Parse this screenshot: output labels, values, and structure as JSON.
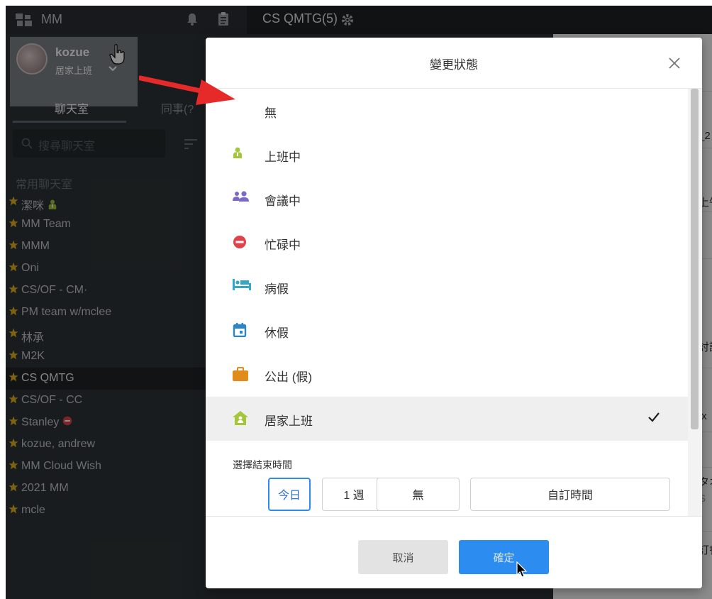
{
  "app": {
    "title": "MM",
    "room_title": "CS QMTG(5)"
  },
  "profile": {
    "name": "kozue",
    "status": "居家上班"
  },
  "tabs": {
    "chat": "聊天室",
    "colleague": "同事(?"
  },
  "search": {
    "placeholder": "搜尋聊天室"
  },
  "section": {
    "favorites": "常用聊天室"
  },
  "rooms": [
    {
      "label": "潔咪",
      "badge": "person-icon",
      "active": false
    },
    {
      "label": "MM Team",
      "active": false
    },
    {
      "label": "MMM",
      "active": false
    },
    {
      "label": "Oni",
      "active": false
    },
    {
      "label": "CS/OF - CM·",
      "active": false
    },
    {
      "label": "PM team w/mclee",
      "active": false
    },
    {
      "label": "林承",
      "active": false
    },
    {
      "label": "M2K",
      "active": false
    },
    {
      "label": "CS QMTG",
      "active": true
    },
    {
      "label": "CS/OF - CC",
      "active": false
    },
    {
      "label": "Stanley",
      "badge": "busy-icon",
      "active": false
    },
    {
      "label": "kozue, andrew",
      "active": false
    },
    {
      "label": "MM Cloud Wish",
      "active": false
    },
    {
      "label": "2021 MM",
      "active": false
    },
    {
      "label": "mcle",
      "active": false
    }
  ],
  "right_fragments": [
    "_2",
    "上午",
    "討論",
    ".x",
    "タオ",
    "S",
    "訂餐"
  ],
  "dialog": {
    "title": "變更狀態",
    "statuses": [
      {
        "label": "無",
        "icon": "none",
        "selected": false
      },
      {
        "label": "上班中",
        "icon": "person-icon",
        "selected": false
      },
      {
        "label": "會議中",
        "icon": "meeting-icon",
        "selected": false
      },
      {
        "label": "忙碌中",
        "icon": "busy-icon",
        "selected": false
      },
      {
        "label": "病假",
        "icon": "bed-icon",
        "selected": false
      },
      {
        "label": "休假",
        "icon": "calendar-icon",
        "selected": false
      },
      {
        "label": "公出 (假)",
        "icon": "briefcase-icon",
        "selected": false
      },
      {
        "label": "居家上班",
        "icon": "home-icon",
        "selected": true
      }
    ],
    "end_time_label": "選擇結束時間",
    "time_options": [
      {
        "label": "今日",
        "selected": true
      },
      {
        "label": "1 週",
        "selected": false
      },
      {
        "label": "無",
        "selected": false
      },
      {
        "label": "自訂時間",
        "selected": false
      }
    ],
    "cancel": "取消",
    "confirm": "確定"
  },
  "colors": {
    "accent": "#2d8cf0",
    "person": "#a4c639",
    "meeting": "#7b68c8",
    "busy": "#e0434b",
    "bed": "#35a7c6",
    "calendar": "#2a86c9",
    "briefcase": "#e28b1d",
    "home": "#a4c639",
    "star": "#e3b41c"
  }
}
